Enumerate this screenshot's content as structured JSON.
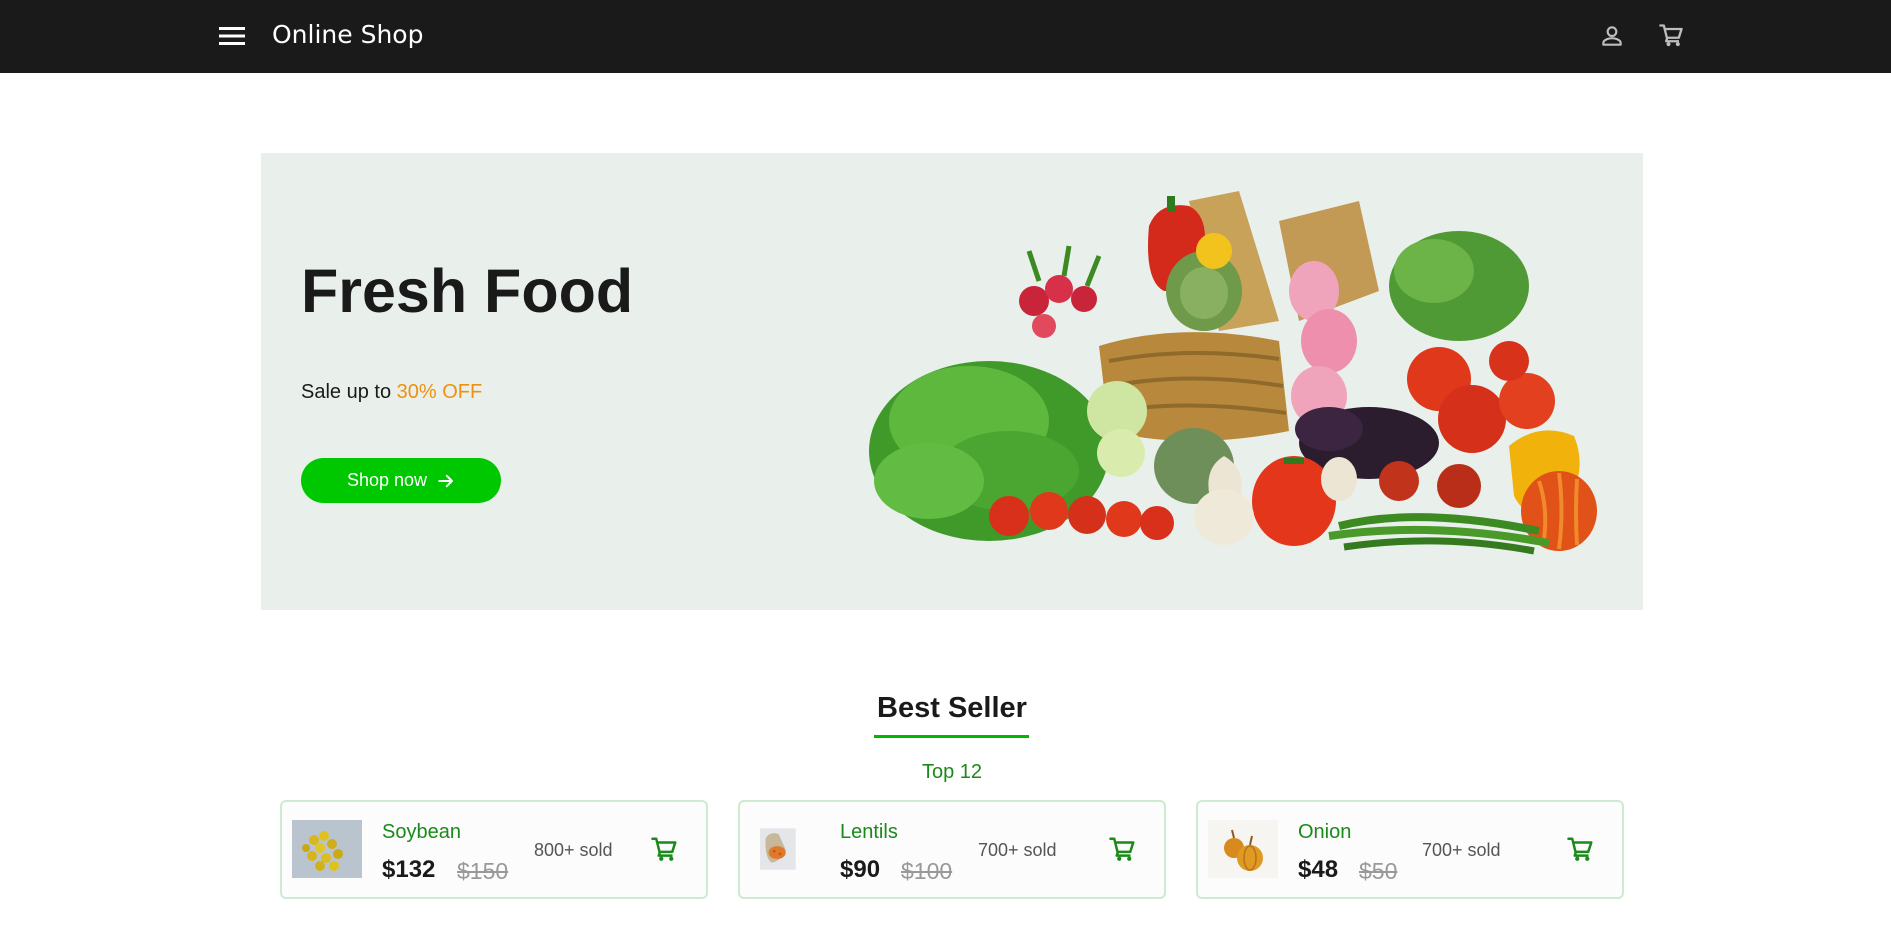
{
  "app": {
    "title": "Online Shop",
    "icons": {
      "menu": "menu-icon",
      "account": "account-icon",
      "cart": "cart-icon"
    }
  },
  "hero": {
    "title": "Fresh Food",
    "subtitle_prefix": "Sale up to ",
    "subtitle_accent": "30% OFF",
    "button_label": "Shop now",
    "button_icon": "arrow-right-icon",
    "colors": {
      "background": "#e9f0ec",
      "accent": "#f0900e",
      "button": "#00c800"
    }
  },
  "best_seller": {
    "title": "Best Seller",
    "subtitle": "Top 12",
    "products": [
      {
        "name": "Soybean",
        "price": "$132",
        "old_price": "$150",
        "sold": "800+ sold"
      },
      {
        "name": "Lentils",
        "price": "$90",
        "old_price": "$100",
        "sold": "700+ sold"
      },
      {
        "name": "Onion",
        "price": "$48",
        "old_price": "$50",
        "sold": "700+ sold"
      }
    ],
    "colors": {
      "product_name": "#1a8a1a",
      "underline": "#00b800",
      "card_border": "#cdebd0"
    }
  }
}
